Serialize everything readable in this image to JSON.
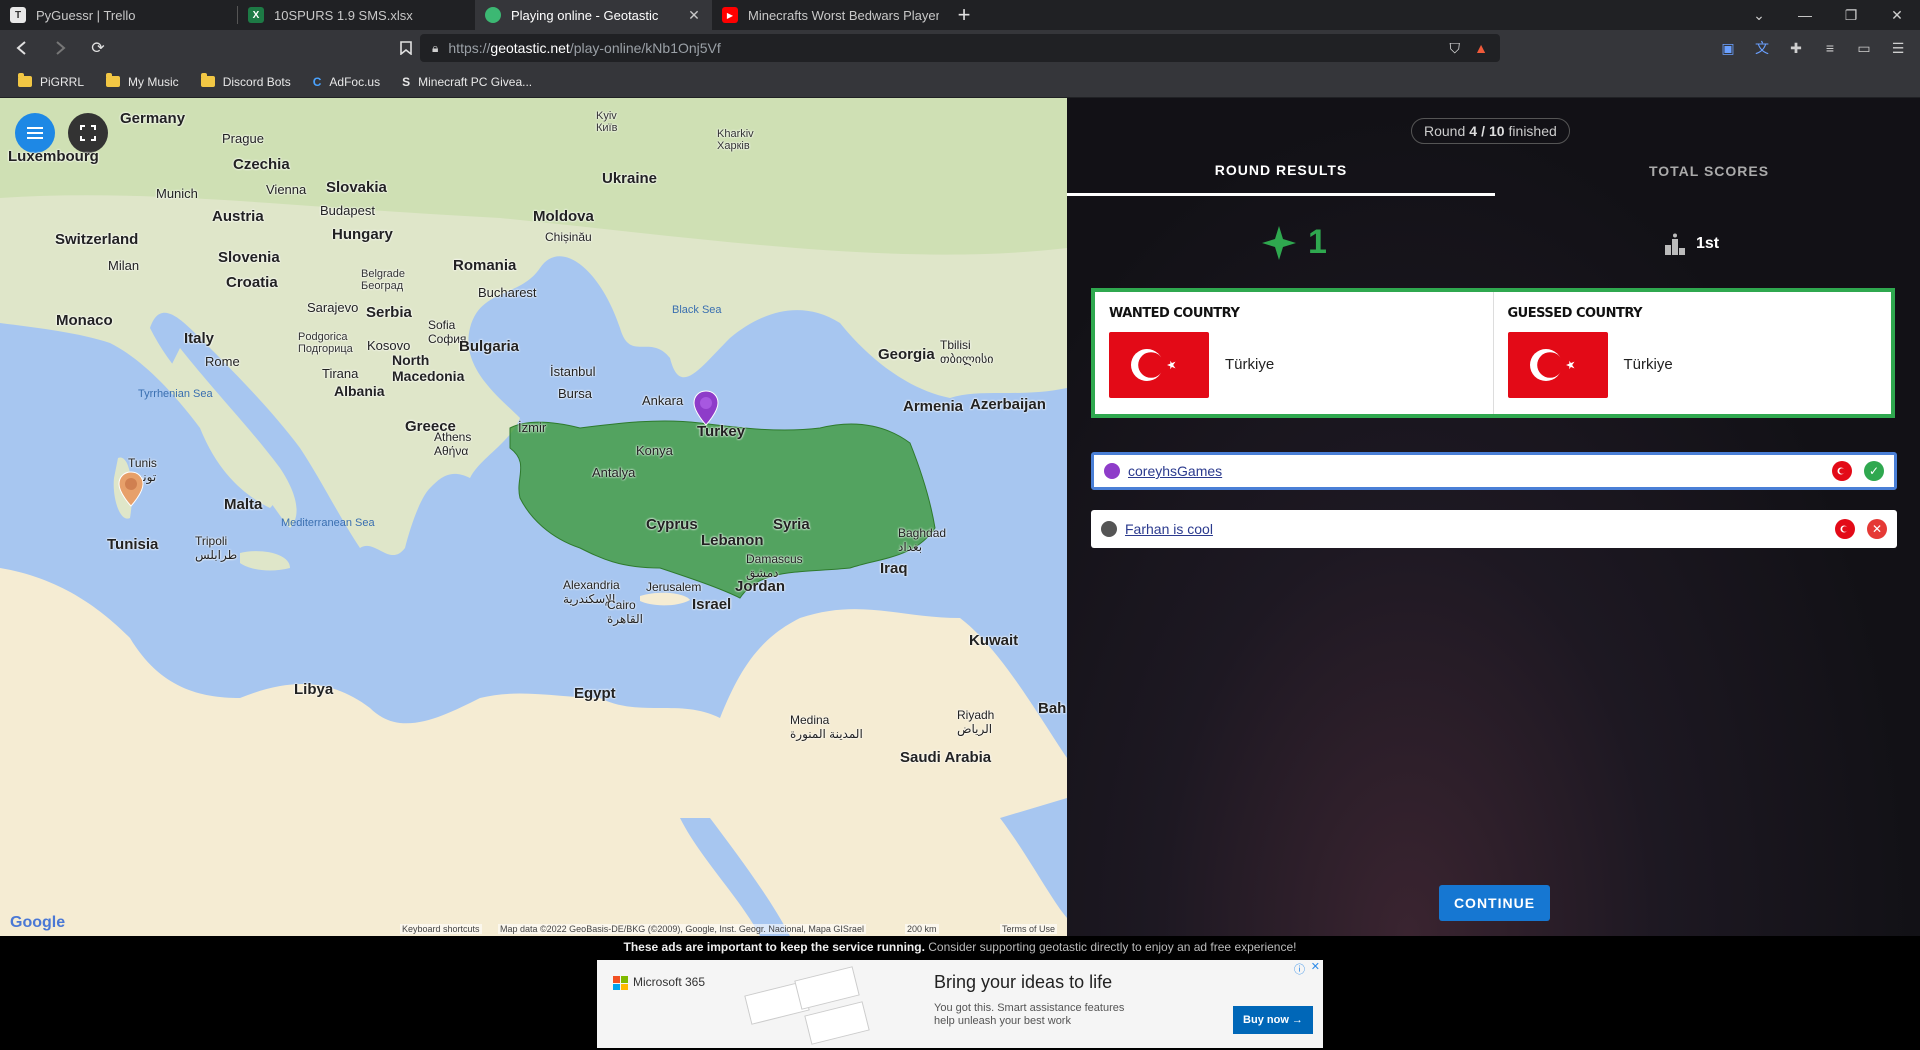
{
  "browser": {
    "tabs": [
      {
        "title": "PyGuessr | Trello",
        "icon": "trello-icon",
        "color": "#e8e8e8",
        "active": false
      },
      {
        "title": "10SPURS 1.9 SMS.xlsx",
        "icon": "excel-icon",
        "color": "#1d7a45",
        "active": false
      },
      {
        "title": "Playing online - Geotastic",
        "icon": "geotastic-icon",
        "color": "#3cb873",
        "active": true
      },
      {
        "title": "Minecrafts Worst Bedwars Player - You",
        "icon": "youtube-icon",
        "color": "#ff0000",
        "active": false
      }
    ],
    "url_prefix": "https://",
    "url_host": "geotastic.net",
    "url_path": "/play-online/kNb1Onj5Vf",
    "bookmarks": [
      {
        "label": "PiGRRL",
        "icon": "folder-icon"
      },
      {
        "label": "My Music",
        "icon": "folder-icon"
      },
      {
        "label": "Discord Bots",
        "icon": "folder-icon"
      },
      {
        "label": "AdFoc.us",
        "icon": "adfocus-icon"
      },
      {
        "label": "Minecraft PC Givea...",
        "icon": "site-icon"
      }
    ]
  },
  "map": {
    "labels": {
      "germany": "Germany",
      "luxembourg": "Luxembourg",
      "prague": "Prague",
      "czechia": "Czechia",
      "kyiv": "Kyiv\nКиїв",
      "kharkiv": "Kharkiv\nХарків",
      "ukraine": "Ukraine",
      "munich": "Munich",
      "vienna": "Vienna",
      "slovakia": "Slovakia",
      "austria": "Austria",
      "budapest": "Budapest",
      "hungary": "Hungary",
      "switzerland": "Switzerland",
      "moldova": "Moldova",
      "chisinau": "Chișinău",
      "milan": "Milan",
      "slovenia": "Slovenia",
      "croatia": "Croatia",
      "romania": "Romania",
      "belgrade": "Belgrade\nБеоград",
      "bucharest": "Bucharest",
      "sarajevo": "Sarajevo",
      "serbia": "Serbia",
      "monaco": "Monaco",
      "italy": "Italy",
      "sofia": "Sofia\nСофия",
      "podgorica": "Podgorica\nПодгорица",
      "kosovo": "Kosovo",
      "bulgaria": "Bulgaria",
      "rome": "Rome",
      "black_sea": "Black Sea",
      "georgia": "Georgia",
      "tbilisi": "Tbilisi\nთბილისი",
      "tirana": "Tirana",
      "north_macedonia": "North\nMacedonia",
      "albania": "Albania",
      "istanbul": "İstanbul",
      "bursa": "Bursa",
      "ankara": "Ankara",
      "turkey": "Turkey",
      "armenia": "Armenia",
      "azerbaijan": "Azerbaijan",
      "tyrrhenian": "Tyrrhenian Sea",
      "greece": "Greece",
      "athens": "Athens\nΑθήνα",
      "izmir": "İzmir",
      "konya": "Konya",
      "tunis": "Tunis\nتونس",
      "antalya": "Antalya",
      "malta": "Malta",
      "syria": "Syria",
      "cyprus": "Cyprus",
      "mediterranean": "Mediterranean Sea",
      "tunisia": "Tunisia",
      "lebanon": "Lebanon",
      "baghdad": "Baghdad\nبغداد",
      "tripoli": "Tripoli\nطرابلس",
      "damascus": "Damascus\nدمشق",
      "iraq": "Iraq",
      "alexandria": "Alexandria\nالإسكندرية",
      "jerusalem": "Jerusalem",
      "jordan": "Jordan",
      "cairo": "Cairo\nالقاهرة",
      "israel": "Israel",
      "kuwait": "Kuwait",
      "libya": "Libya",
      "egypt": "Egypt",
      "riyadh": "Riyadh\nالرياض",
      "medina": "Medina\nالمدينة المنورة",
      "bah": "Bah",
      "saudi": "Saudi Arabia"
    },
    "footer": {
      "keyboard": "Keyboard shortcuts",
      "mapdata": "Map data ©2022 GeoBasis-DE/BKG (©2009), Google, Inst. Geogr. Nacional, Mapa GISrael",
      "scale": "200 km",
      "terms": "Terms of Use",
      "google": "Google"
    }
  },
  "panel": {
    "round_prefix": "Round",
    "round_current": "4",
    "round_total": "10",
    "round_suffix": "finished",
    "tab_round": "ROUND RESULTS",
    "tab_total": "TOTAL SCORES",
    "score": "1",
    "place": "1st",
    "wanted_label": "WANTED COUNTRY",
    "wanted_country": "Türkiye",
    "guessed_label": "GUESSED COUNTRY",
    "guessed_country": "Türkiye",
    "players": [
      {
        "name": "coreyhsGames",
        "correct": true,
        "avatar_color": "#8e3cc9"
      },
      {
        "name": "Farhan is cool",
        "correct": false,
        "avatar_color": "#555555"
      }
    ],
    "continue": "CONTINUE",
    "colors": {
      "accent": "#2fa84f",
      "button": "#1677d2",
      "error": "#e53935"
    }
  },
  "ads": {
    "notice_bold": "These ads are important to keep the service running.",
    "notice_rest": "Consider supporting geotastic directly to enjoy an ad free experience!",
    "brand": "Microsoft 365",
    "headline": "Bring your ideas to life",
    "body": "You got this. Smart assistance features\nhelp unleash your best work",
    "cta": "Buy now →"
  }
}
